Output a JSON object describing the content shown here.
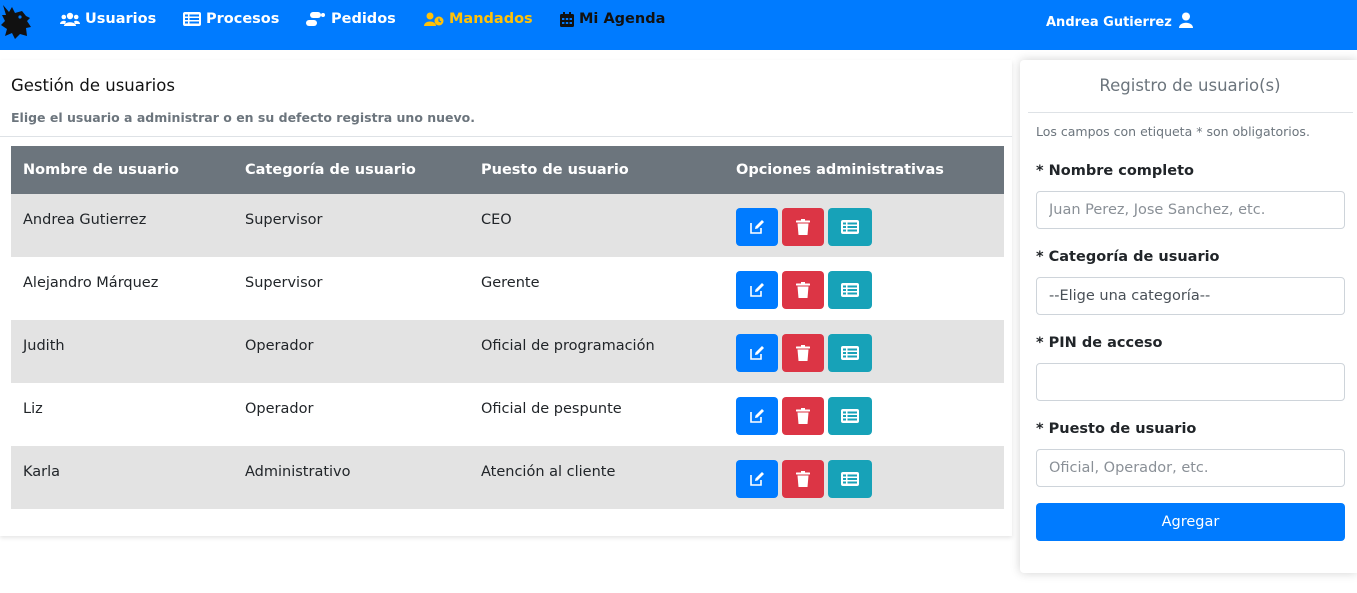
{
  "navbar": {
    "logo_icon": "wolf-logo-icon",
    "items": [
      {
        "label": "Usuarios",
        "icon": "users-icon"
      },
      {
        "label": "Procesos",
        "icon": "list-icon"
      },
      {
        "label": "Pedidos",
        "icon": "shipping-icon"
      },
      {
        "label": "Mandados",
        "icon": "user-clock-icon"
      },
      {
        "label": "Mi Agenda",
        "icon": "calendar-icon"
      }
    ],
    "user_name": "Andrea Gutierrez",
    "user_icon": "user-icon",
    "colors": {
      "background": "#007bff",
      "active": "#ffc107"
    }
  },
  "main": {
    "title": "Gestión de usuarios",
    "subtitle": "Elige el usuario a administrar o en su defecto registra uno nuevo.",
    "table": {
      "headers": [
        "Nombre de usuario",
        "Categoría de usuario",
        "Puesto de usuario",
        "Opciones administrativas"
      ],
      "rows": [
        [
          "Andrea Gutierrez",
          "Supervisor",
          "CEO"
        ],
        [
          "Alejandro Márquez",
          "Supervisor",
          "Gerente"
        ],
        [
          "Judith",
          "Operador",
          "Oficial de programación"
        ],
        [
          "Liz",
          "Operador",
          "Oficial de pespunte"
        ],
        [
          "Karla",
          "Administrativo",
          "Atención al cliente"
        ]
      ],
      "action_icons": [
        "edit-icon",
        "trash-icon",
        "list-alt-icon"
      ],
      "colors": {
        "header": "#6c757d",
        "edit": "#007bff",
        "delete": "#dc3545",
        "detail": "#17a2b8"
      }
    }
  },
  "form": {
    "title": "Registro de usuario(s)",
    "note": "Los campos con etiqueta * son obligatorios.",
    "fields": {
      "full_name": {
        "label": "* Nombre completo",
        "placeholder": "Juan Perez, Jose Sanchez, etc.",
        "value": ""
      },
      "category": {
        "label": "* Categoría de usuario",
        "selected": "--Elige una categoría--"
      },
      "pin": {
        "label": "* PIN de acceso",
        "value": ""
      },
      "position": {
        "label": "* Puesto de usuario",
        "placeholder": "Oficial, Operador, etc.",
        "value": ""
      }
    },
    "submit_label": "Agregar"
  }
}
